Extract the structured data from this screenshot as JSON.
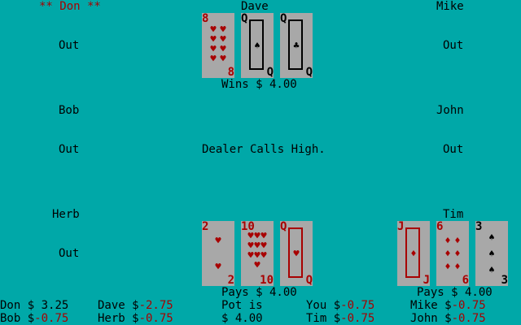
{
  "players": {
    "don": {
      "name": "** Don **",
      "status": ""
    },
    "dave": {
      "name": "Dave",
      "result": "Wins $ 4.00"
    },
    "mike": {
      "name": "Mike",
      "status": "Out"
    },
    "bob": {
      "name": "Bob",
      "status": "Out"
    },
    "john": {
      "name": "John",
      "status": "Out"
    },
    "herb": {
      "name": "Herb",
      "status": "Out"
    },
    "tim": {
      "name": "Tim",
      "result": "Pays $ 4.00"
    },
    "don_status": "Out"
  },
  "center_message": "Dealer Calls High.",
  "you_result": "Pays $ 4.00",
  "hands": {
    "dave": [
      {
        "rank": "8",
        "suit": "hearts",
        "color": "red",
        "icon": "heart-icon"
      },
      {
        "rank": "Q",
        "suit": "spades",
        "color": "black",
        "icon": "spade-icon"
      },
      {
        "rank": "Q",
        "suit": "clubs",
        "color": "black",
        "icon": "club-icon"
      }
    ],
    "you": [
      {
        "rank": "2",
        "suit": "hearts",
        "color": "red",
        "icon": "heart-icon"
      },
      {
        "rank": "10",
        "suit": "hearts",
        "color": "red",
        "icon": "heart-icon"
      },
      {
        "rank": "Q",
        "suit": "hearts",
        "color": "red",
        "icon": "heart-icon"
      }
    ],
    "tim": [
      {
        "rank": "J",
        "suit": "diamonds",
        "color": "red",
        "icon": "diamond-icon"
      },
      {
        "rank": "6",
        "suit": "diamonds",
        "color": "red",
        "icon": "diamond-icon"
      },
      {
        "rank": "3",
        "suit": "spades",
        "color": "black",
        "icon": "spade-icon"
      }
    ]
  },
  "scoreboard": {
    "don": {
      "label": "Don $",
      "amount": " 3.25"
    },
    "bob": {
      "label": "Bob $",
      "amount": "-0.75"
    },
    "dave": {
      "label": "Dave $",
      "amount": "-2.75"
    },
    "herb": {
      "label": "Herb $",
      "amount": "-0.75"
    },
    "pot_label": "Pot is",
    "pot_amount": "$ 4.00",
    "you": {
      "label": "You $",
      "amount": "-0.75"
    },
    "tim": {
      "label": "Tim $",
      "amount": "-0.75"
    },
    "mike": {
      "label": "Mike $",
      "amount": "-0.75"
    },
    "john": {
      "label": "John $",
      "amount": "-0.75"
    }
  },
  "colors": {
    "table": "#00a8a8",
    "card": "#a8a8a8",
    "red": "#a80000",
    "black": "#000000"
  }
}
